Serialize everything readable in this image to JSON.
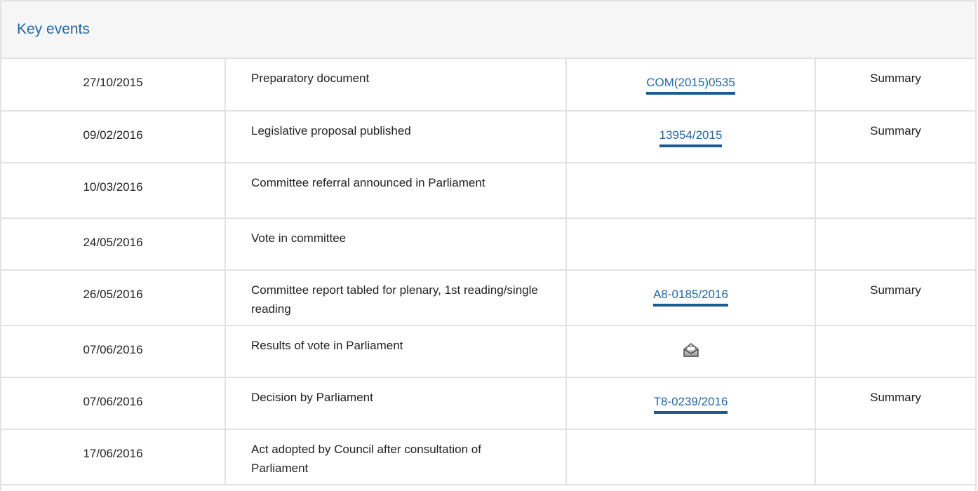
{
  "panel": {
    "title": "Key events"
  },
  "events": [
    {
      "date": "27/10/2015",
      "event": "Preparatory document",
      "reference": "COM(2015)0535",
      "summary": "Summary"
    },
    {
      "date": "09/02/2016",
      "event": "Legislative proposal published",
      "reference": "13954/2015",
      "summary": "Summary"
    },
    {
      "date": "10/03/2016",
      "event": "Committee referral announced in Parliament",
      "reference": "",
      "summary": ""
    },
    {
      "date": "24/05/2016",
      "event": "Vote in committee",
      "reference": "",
      "summary": ""
    },
    {
      "date": "26/05/2016",
      "event": "Committee report tabled for plenary, 1st reading/single reading",
      "reference": "A8-0185/2016",
      "summary": "Summary"
    },
    {
      "date": "07/06/2016",
      "event": "Results of vote in Parliament",
      "reference_icon": "vote-results-icon",
      "summary": ""
    },
    {
      "date": "07/06/2016",
      "event": "Decision by Parliament",
      "reference": "T8-0239/2016",
      "summary": "Summary"
    },
    {
      "date": "17/06/2016",
      "event": "Act adopted by Council after consultation of Parliament",
      "reference": "",
      "summary": ""
    }
  ],
  "colors": {
    "link": "#2467a4",
    "border": "#e2e2e2",
    "header_bg": "#f6f6f6"
  }
}
